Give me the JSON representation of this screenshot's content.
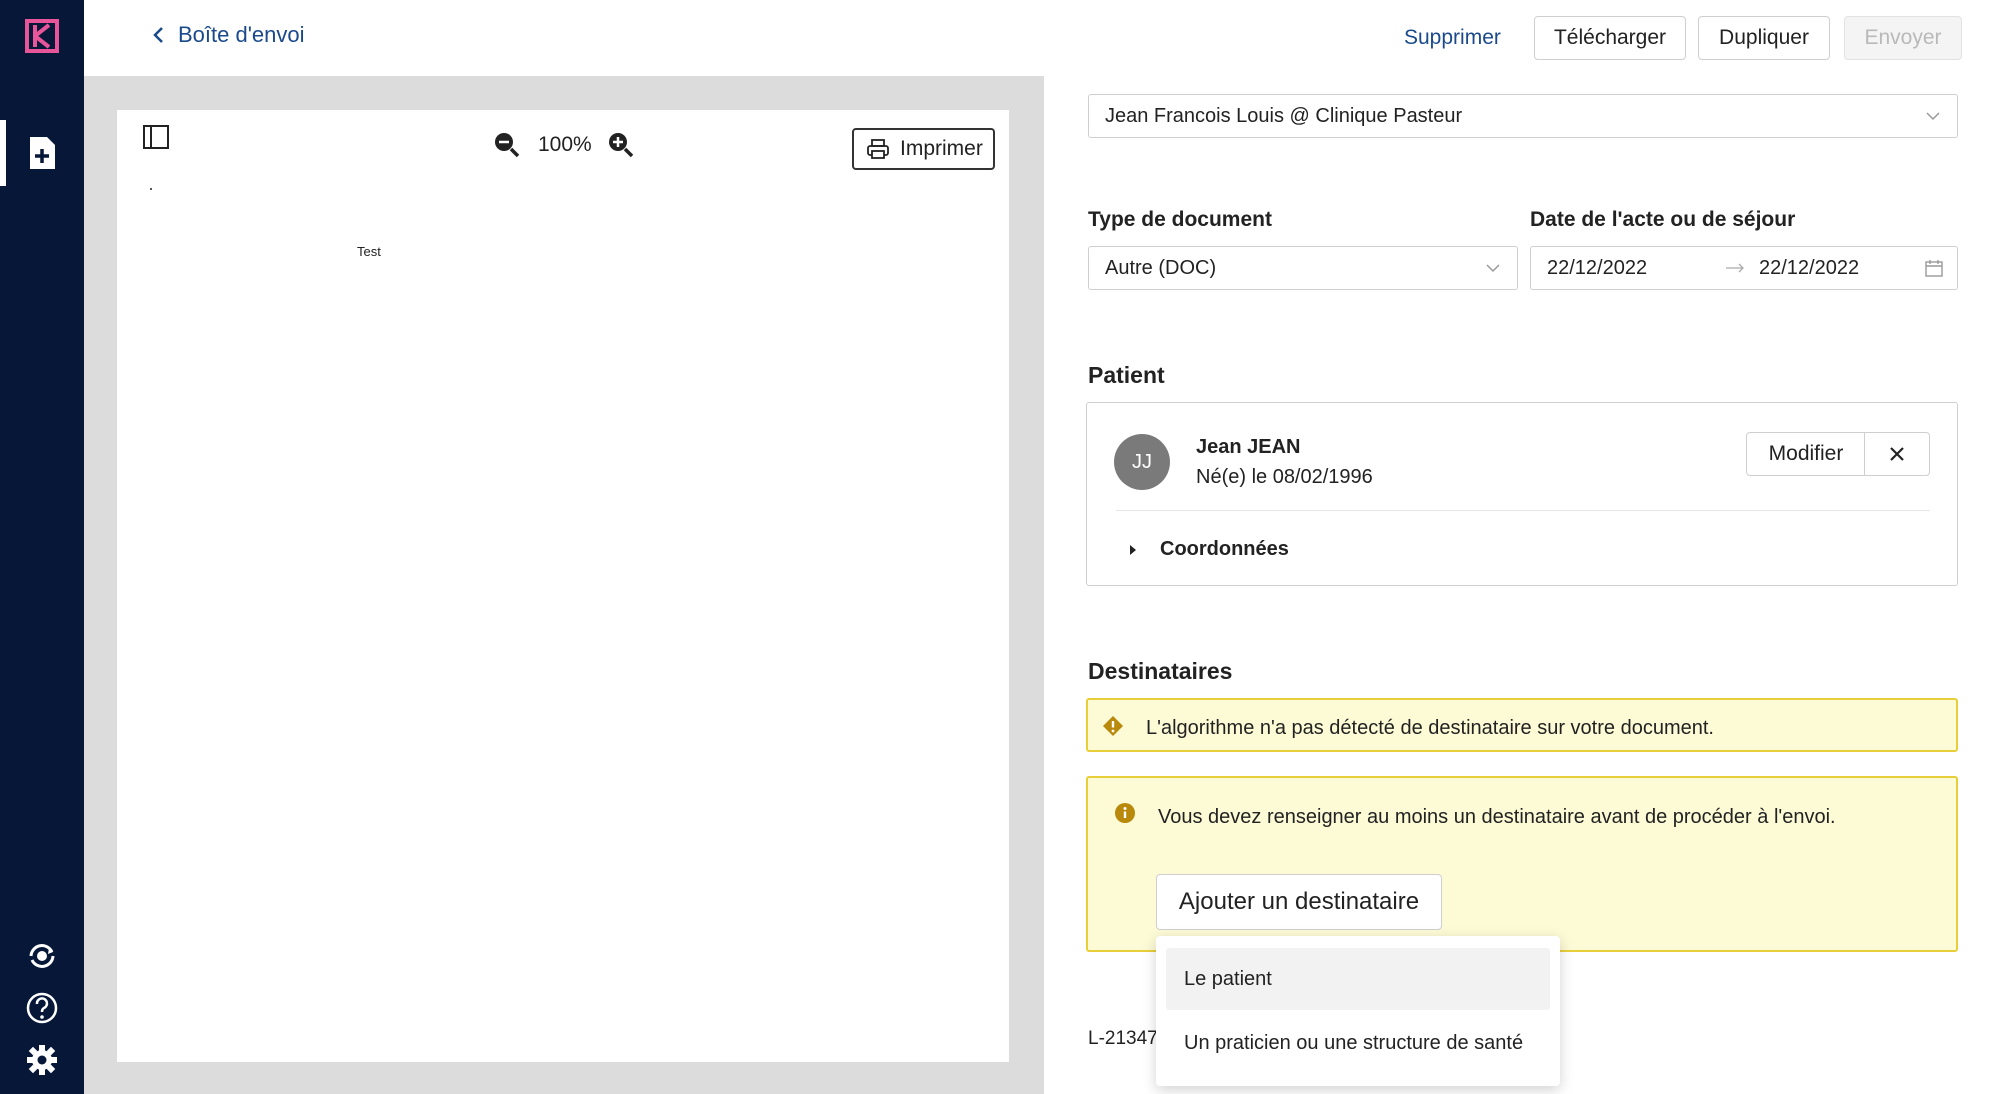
{
  "topbar": {
    "back_label": "Boîte d'envoi",
    "delete_label": "Supprimer",
    "download_label": "Télécharger",
    "duplicate_label": "Dupliquer",
    "send_label": "Envoyer"
  },
  "viewer": {
    "zoom": "100%",
    "print_label": "Imprimer",
    "document_text": "Test"
  },
  "form": {
    "sender_value": "Jean Francois Louis @ Clinique Pasteur",
    "doc_type_label": "Type de document",
    "doc_type_value": "Autre (DOC)",
    "date_label": "Date de l'acte ou de séjour",
    "date_start": "22/12/2022",
    "date_end": "22/12/2022"
  },
  "patient": {
    "section_title": "Patient",
    "initials": "JJ",
    "name": "Jean JEAN",
    "birth": "Né(e) le 08/02/1996",
    "modify_label": "Modifier",
    "details_label": "Coordonnées"
  },
  "recipients": {
    "section_title": "Destinataires",
    "warning": "L'algorithme n'a pas détecté de destinataire sur votre document.",
    "info": "Vous devez renseigner au moins un destinataire avant de procéder à l'envoi.",
    "add_label": "Ajouter un destinataire",
    "options": [
      "Le patient",
      "Un praticien ou une structure de santé"
    ]
  },
  "footer_ref": "L-21347",
  "colors": {
    "sidebar": "#071738",
    "link": "#1a4a8c",
    "warning_bg": "#fdfbd6",
    "warning_border": "#e8cf3a",
    "logo": "#e8559a"
  }
}
